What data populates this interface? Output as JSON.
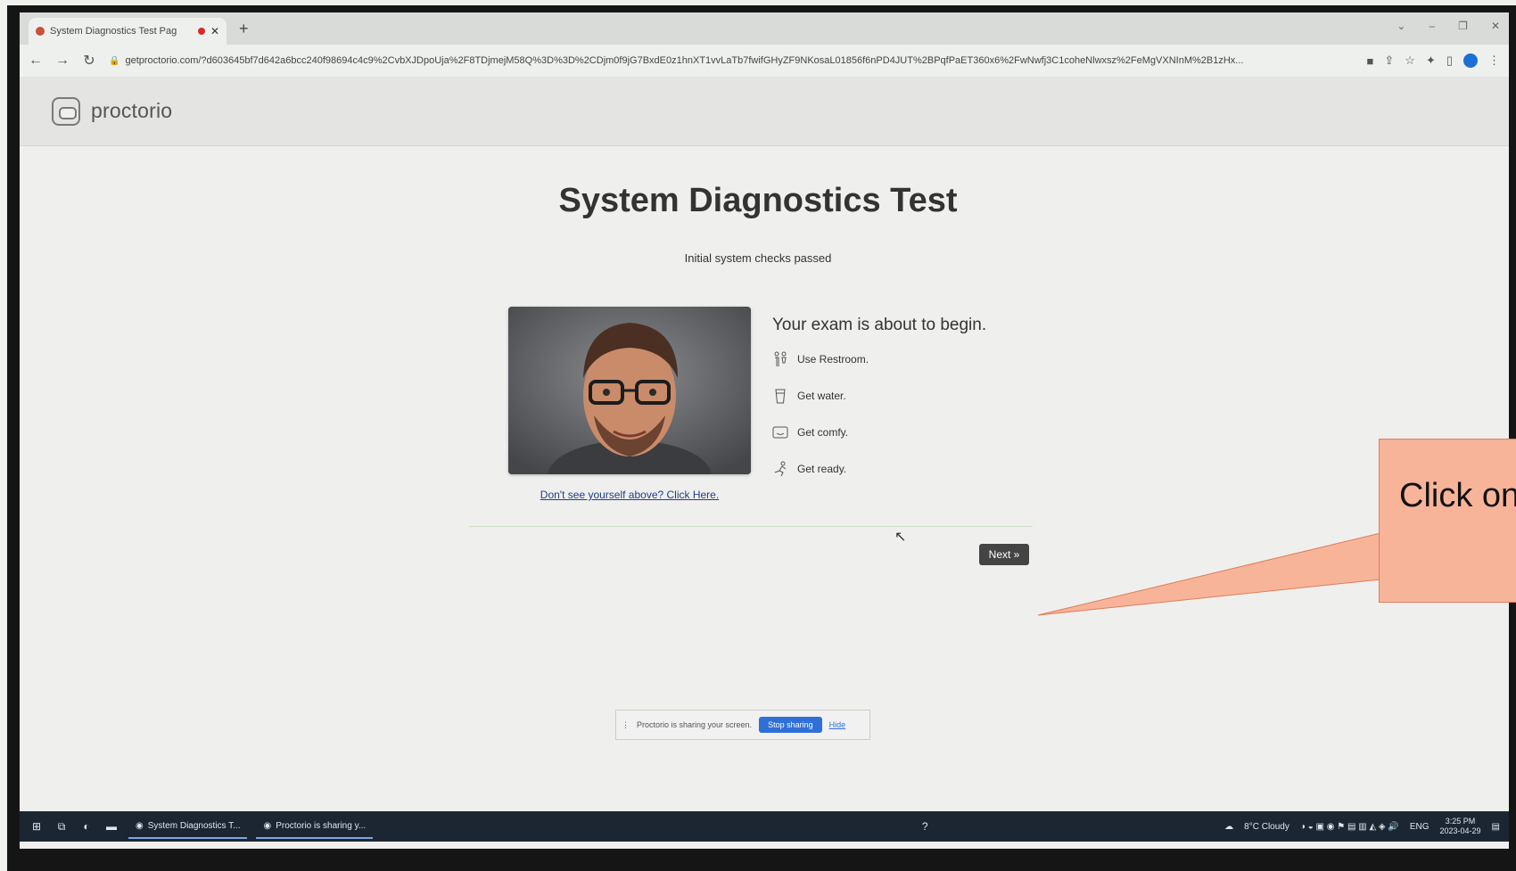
{
  "browser": {
    "tab_title": "System Diagnostics Test Pag",
    "new_tab_symbol": "+",
    "url": "getproctorio.com/?d603645bf7d642a6bcc240f98694c4c9%2CvbXJDpoUja%2F8TDjmejM58Q%3D%3D%2CDjm0f9jG7BxdE0z1hnXT1vvLaTb7fwifGHyZF9NKosaL01856f6nPD4JUT%2BPqfPaET360x6%2FwNwfj3C1coheNlwxsz%2FeMgVXNInM%2B1zHx..."
  },
  "site": {
    "logo_text": "proctorio"
  },
  "main": {
    "title": "System Diagnostics Test",
    "subtitle": "Initial system checks passed",
    "checklist_heading": "Your exam is about to begin.",
    "checklist": [
      {
        "icon": "restroom-icon",
        "label": "Use Restroom."
      },
      {
        "icon": "water-icon",
        "label": "Get water."
      },
      {
        "icon": "comfy-icon",
        "label": "Get comfy."
      },
      {
        "icon": "ready-icon",
        "label": "Get ready."
      }
    ],
    "dont_see_link": "Don't see yourself above? Click Here.",
    "next_button": "Next »"
  },
  "share_notice": {
    "text": "Proctorio is sharing your screen.",
    "stop_label": "Stop sharing",
    "hide_label": "Hide"
  },
  "taskbar": {
    "apps": [
      "System Diagnostics T...",
      "Proctorio is sharing y..."
    ],
    "weather": "8°C  Cloudy",
    "lang": "ENG",
    "time": "3:25 PM",
    "date": "2023-04-29"
  },
  "callout": {
    "text": "Click on"
  },
  "colors": {
    "next_button_bg": "#444444",
    "stop_sharing_bg": "#2f6fd8",
    "callout_fill": "#f7b499",
    "callout_border": "#e07c5a"
  }
}
